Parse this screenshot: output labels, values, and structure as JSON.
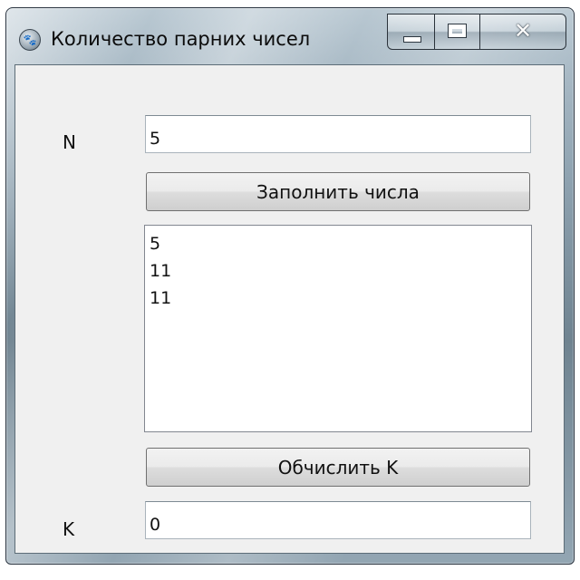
{
  "window": {
    "title": "Количество парних чисел",
    "icon": "paw-icon",
    "controls": {
      "minimize": "minimize-icon",
      "maximize": "maximize-icon",
      "close": "close-icon"
    }
  },
  "form": {
    "n_label": "N",
    "n_value": "5",
    "fill_button_label": "Заполнить числа",
    "numbers": [
      "5",
      "11",
      "11"
    ],
    "compute_button_label": "Обчислить K",
    "k_label": "K",
    "k_value": "0"
  },
  "colors": {
    "client_background": "#f0f0f0",
    "window_frame": "#6f8390"
  }
}
